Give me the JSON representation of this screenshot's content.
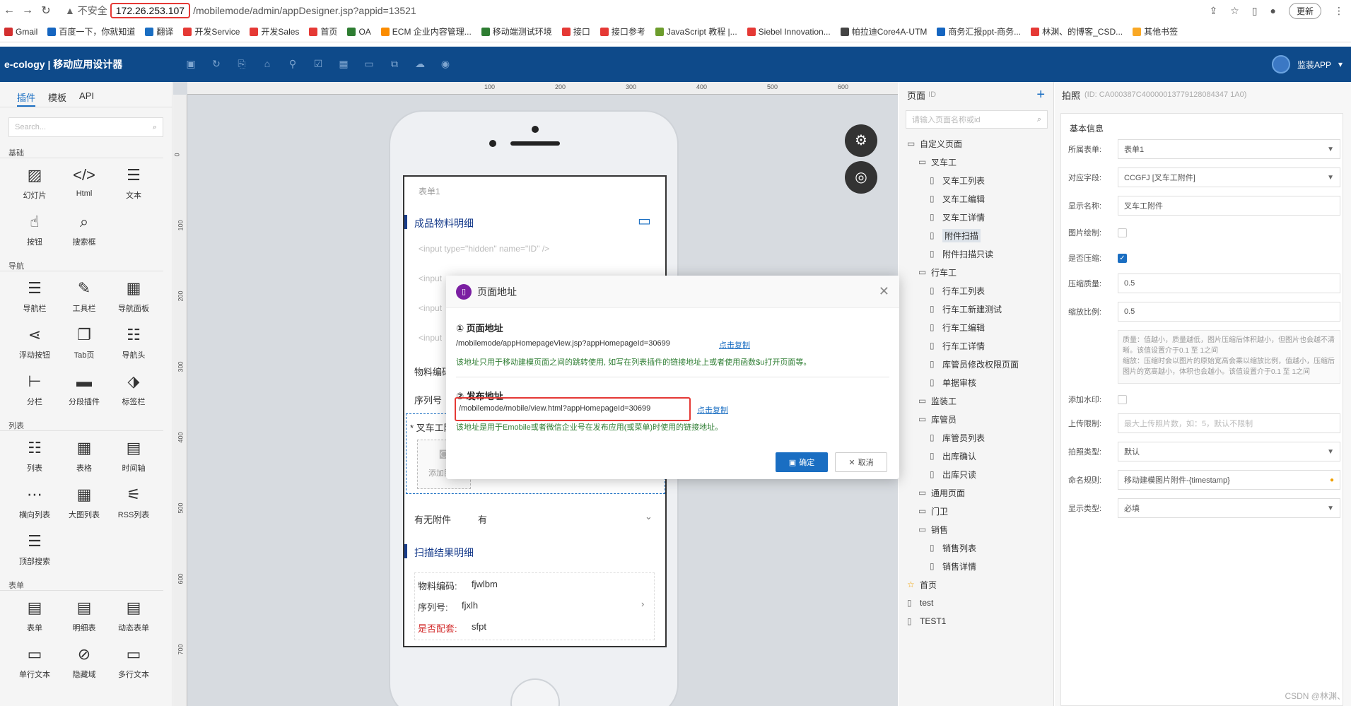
{
  "browser": {
    "insecure": "不安全",
    "host": "172.26.253.107",
    "path": "/mobilemode/admin/appDesigner.jsp?appid=13521",
    "update": "更新",
    "bookmarks": [
      "Gmail",
      "百度一下，你就知道",
      "翻译",
      "开发Service",
      "开发Sales",
      "首页",
      "OA",
      "ECM 企业内容管理...",
      "移动端测试环境",
      "接口",
      "接口参考",
      "JavaScript 教程 |...",
      "Siebel Innovation...",
      "帕拉迪Core4A-UTM",
      "商务汇报ppt-商务...",
      "林渊、的博客_CSD...",
      "其他书签"
    ]
  },
  "app": {
    "title": "e-cology | 移动应用设计器",
    "user": "监装APP"
  },
  "left": {
    "tabs": [
      "插件",
      "模板",
      "API"
    ],
    "search_placeholder": "Search...",
    "sections": [
      {
        "name": "基础",
        "items": [
          "幻灯片",
          "Html",
          "文本",
          "按钮",
          "搜索框"
        ]
      },
      {
        "name": "导航",
        "items": [
          "导航栏",
          "工具栏",
          "导航面板",
          "浮动按钮",
          "Tab页",
          "导航头",
          "分栏",
          "分段插件",
          "标签栏"
        ]
      },
      {
        "name": "列表",
        "items": [
          "列表",
          "表格",
          "时间轴",
          "横向列表",
          "大图列表",
          "RSS列表",
          "顶部搜索"
        ]
      },
      {
        "name": "表单",
        "items": [
          "表单",
          "明细表",
          "动态表单",
          "单行文本",
          "隐藏域",
          "多行文本"
        ]
      }
    ]
  },
  "ruler": {
    "top": [
      "100",
      "200",
      "300",
      "400",
      "500",
      "600"
    ],
    "left": [
      "0",
      "100",
      "200",
      "300",
      "400",
      "500",
      "600",
      "700"
    ]
  },
  "phone": {
    "form_name": "表单1",
    "section1": "成品物料明细",
    "input_code": "<input type=\"hidden\" name=\"ID\" />",
    "input_short": "<input",
    "row_wlbm": "物料编码",
    "row_xlh": "序列号",
    "forklift": "* 叉车工附件",
    "add_image": "添加图片",
    "has_attach_label": "有无附件",
    "has_attach_value": "有",
    "section2": "扫描结果明细",
    "r1_label": "物料编码:",
    "r1_value": "fjwlbm",
    "r2_label": "序列号:",
    "r2_value": "fjxlh",
    "r3_label": "是否配套:",
    "r3_value": "sfpt"
  },
  "pages": {
    "title": "页面",
    "id_label": "ID",
    "search_placeholder": "请输入页面名称或id",
    "tree": [
      {
        "label": "自定义页面",
        "level": 0,
        "icon": "folder"
      },
      {
        "label": "叉车工",
        "level": 1,
        "icon": "folder"
      },
      {
        "label": "叉车工列表",
        "level": 2,
        "icon": "page"
      },
      {
        "label": "叉车工编辑",
        "level": 2,
        "icon": "page"
      },
      {
        "label": "叉车工详情",
        "level": 2,
        "icon": "page"
      },
      {
        "label": "附件扫描",
        "level": 2,
        "icon": "page",
        "selected": true
      },
      {
        "label": "附件扫描只读",
        "level": 2,
        "icon": "page"
      },
      {
        "label": "行车工",
        "level": 1,
        "icon": "folder"
      },
      {
        "label": "行车工列表",
        "level": 2,
        "icon": "page"
      },
      {
        "label": "行车工新建测试",
        "level": 2,
        "icon": "page"
      },
      {
        "label": "行车工编辑",
        "level": 2,
        "icon": "page"
      },
      {
        "label": "行车工详情",
        "level": 2,
        "icon": "page"
      },
      {
        "label": "库管员修改权限页面",
        "level": 2,
        "icon": "page"
      },
      {
        "label": "单据审核",
        "level": 2,
        "icon": "page"
      },
      {
        "label": "监装工",
        "level": 1,
        "icon": "folder"
      },
      {
        "label": "库管员",
        "level": 1,
        "icon": "folder"
      },
      {
        "label": "库管员列表",
        "level": 2,
        "icon": "page"
      },
      {
        "label": "出库确认",
        "level": 2,
        "icon": "page"
      },
      {
        "label": "出库只读",
        "level": 2,
        "icon": "page"
      },
      {
        "label": "通用页面",
        "level": 1,
        "icon": "folder"
      },
      {
        "label": "门卫",
        "level": 1,
        "icon": "folder"
      },
      {
        "label": "销售",
        "level": 1,
        "icon": "folder"
      },
      {
        "label": "销售列表",
        "level": 2,
        "icon": "page"
      },
      {
        "label": "销售详情",
        "level": 2,
        "icon": "page"
      },
      {
        "label": "首页",
        "level": 0,
        "icon": "star"
      },
      {
        "label": "test",
        "level": 0,
        "icon": "page"
      },
      {
        "label": "TEST1",
        "level": 0,
        "icon": "page"
      }
    ]
  },
  "props": {
    "title": "拍照",
    "id": "(ID: CA000387C40000013779128084347 1A0)",
    "section": "基本信息",
    "form_label": "所属表单:",
    "form_value": "表单1",
    "field_label": "对应字段:",
    "field_value": "CCGFJ [叉车工附件]",
    "display_label": "显示名称:",
    "display_value": "叉车工附件",
    "draw_label": "图片绘制:",
    "compress_label": "是否压缩:",
    "quality_label": "压缩质量:",
    "quality_value": "0.5",
    "scale_label": "缩放比例:",
    "scale_value": "0.5",
    "tip": "质量：值越小，质量越低，图片压缩后体积越小，但图片也会越不清晰。该值设置介于0.1 至 1之间\n缩放：压缩时会以图片的原始宽高会乘以缩放比例，值越小，压缩后图片的宽高越小，体积也会越小。该值设置介于0.1 至 1之间",
    "watermark_label": "添加水印:",
    "upload_label": "上传限制:",
    "upload_placeholder": "最大上传照片数，如：5，默认不限制",
    "photo_type_label": "拍照类型:",
    "photo_type_value": "默认",
    "naming_label": "命名规则:",
    "naming_value": "移动建模图片附件-{timestamp}",
    "show_type_label": "显示类型:",
    "show_type_value": "必填"
  },
  "dialog": {
    "title": "页面地址",
    "s1_title": "① 页面地址",
    "s1_url": "/mobilemode/appHomepageView.jsp?appHomepageId=30699",
    "copy": "点击复制",
    "s1_note": "该地址只用于移动建模页面之间的跳转使用, 如写在列表插件的链接地址上或者使用函数$u打开页面等。",
    "s2_title": "② 发布地址",
    "s2_url": "/mobilemode/mobile/view.html?appHomepageId=30699",
    "s2_note": "该地址是用于Emobile或者微信企业号在发布应用(或菜单)时使用的链接地址。",
    "ok": "确定",
    "cancel": "取消"
  },
  "watermark": "CSDN @林渊、"
}
